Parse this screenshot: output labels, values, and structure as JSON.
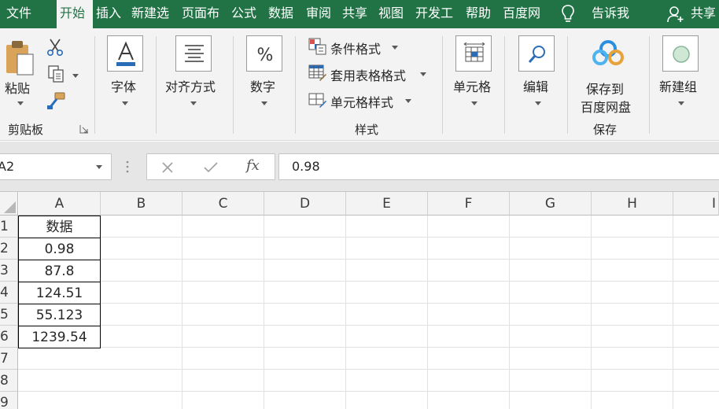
{
  "tabs": [
    {
      "label": "文件",
      "active": false
    },
    {
      "label": "开始",
      "active": true
    },
    {
      "label": "插入",
      "active": false
    },
    {
      "label": "新建选",
      "active": false
    },
    {
      "label": "页面布",
      "active": false
    },
    {
      "label": "公式",
      "active": false
    },
    {
      "label": "数据",
      "active": false
    },
    {
      "label": "审阅",
      "active": false
    },
    {
      "label": "共享",
      "active": false
    },
    {
      "label": "视图",
      "active": false
    },
    {
      "label": "开发工",
      "active": false
    },
    {
      "label": "帮助",
      "active": false
    },
    {
      "label": "百度网",
      "active": false
    }
  ],
  "tellme": "告诉我",
  "share": "共享",
  "ribbon": {
    "clipboard": {
      "paste": "粘贴",
      "group": "剪贴板"
    },
    "font": {
      "label": "字体"
    },
    "alignment": {
      "label": "对齐方式"
    },
    "number": {
      "label": "数字"
    },
    "styles": {
      "conditional": "条件格式",
      "table": "套用表格格式",
      "cell_styles": "单元格样式",
      "group": "样式"
    },
    "cells": {
      "label": "单元格"
    },
    "editing": {
      "label": "编辑"
    },
    "save": {
      "line1": "保存到",
      "line2": "百度网盘",
      "group": "保存"
    },
    "newgroup": {
      "label": "新建组"
    }
  },
  "formula_bar": {
    "name_box": "A2",
    "fx": "fx",
    "value": "0.98"
  },
  "grid": {
    "columns": [
      "A",
      "B",
      "C",
      "D",
      "E",
      "F",
      "G",
      "H",
      "I"
    ],
    "rows": [
      "1",
      "2",
      "3",
      "4",
      "5",
      "6",
      "7",
      "8",
      "9"
    ],
    "cells": [
      "数据",
      "0.98",
      "87.8",
      "124.51",
      "55.123",
      "1239.54"
    ]
  },
  "colors": {
    "accent": "#217346",
    "ribbon": "#f3f3f3"
  }
}
